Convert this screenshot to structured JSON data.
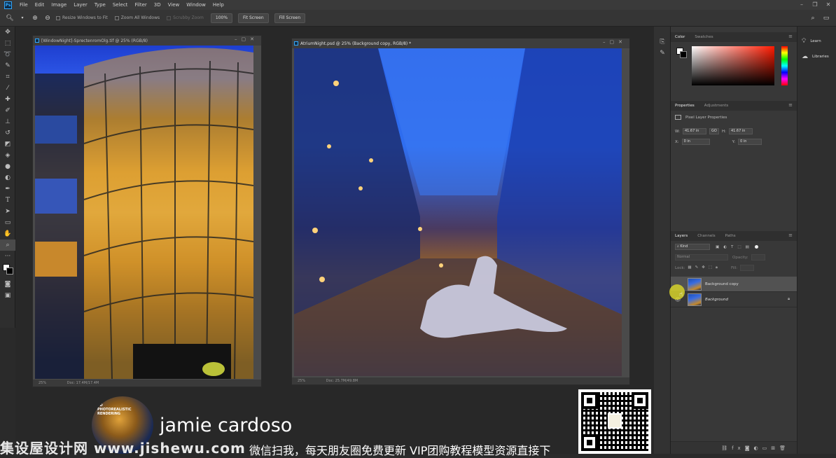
{
  "app": {
    "name": "Photoshop",
    "logo_text": "Ps"
  },
  "menu": [
    "File",
    "Edit",
    "Image",
    "Layer",
    "Type",
    "Select",
    "Filter",
    "3D",
    "View",
    "Window",
    "Help"
  ],
  "options_bar": {
    "resize_windows": "Resize Windows to Fit",
    "zoom_all": "Zoom All Windows",
    "scrubby_zoom": "Scrubby Zoom",
    "zoom_level": "100%",
    "fit_screen": "Fit Screen",
    "fill_screen": "Fill Screen"
  },
  "documents": [
    {
      "title": "[WindowNight]-SprectenromOlg.tif @ 25% (RGB/8)",
      "status_zoom": "25%",
      "status_doc": "Doc: 17.4M/17.4M"
    },
    {
      "title": "AtriumNight.psd @ 25% (Background copy, RGB/8) *",
      "status_zoom": "25%",
      "status_doc": "Doc: 25.7M/49.8M"
    }
  ],
  "color_panel": {
    "tabs": [
      "Color",
      "Swatches"
    ]
  },
  "properties_panel": {
    "tabs": [
      "Properties",
      "Adjustments"
    ],
    "heading": "Pixel Layer Properties",
    "w_label": "W:",
    "w_value": "41.67 in",
    "go_label": "GO",
    "h_label": "H:",
    "h_value": "41.67 in",
    "x_label": "X:",
    "x_value": "0 in",
    "y_label": "Y:",
    "y_value": "0 in"
  },
  "layers_panel": {
    "tabs": [
      "Layers",
      "Channels",
      "Paths"
    ],
    "filter_kind": "Kind",
    "blend_mode": "Normal",
    "opacity_label": "Opacity:",
    "lock_label": "Lock:",
    "fill_label": "Fill:",
    "layers": [
      {
        "name": "Background copy",
        "selected": true
      },
      {
        "name": "Background",
        "selected": false,
        "locked": true
      }
    ]
  },
  "learn_column": [
    {
      "icon": "lightbulb-icon",
      "label": "Learn"
    },
    {
      "icon": "libraries-icon",
      "label": "Libraries"
    }
  ],
  "overlay": {
    "author": "jamie cardoso",
    "avatar_text": "3D PHOTOREALISTIC RENDERING",
    "watermark_site": "集设屋设计网 www.jishewu.com",
    "watermark_promo": "微信扫我，每天朋友圈免费更新 VIP团购教程模型资源直接下"
  },
  "colors": {
    "accent": "#31a8ff",
    "selected_layer": "#525252",
    "cursor_highlight": "#d6d22a"
  }
}
